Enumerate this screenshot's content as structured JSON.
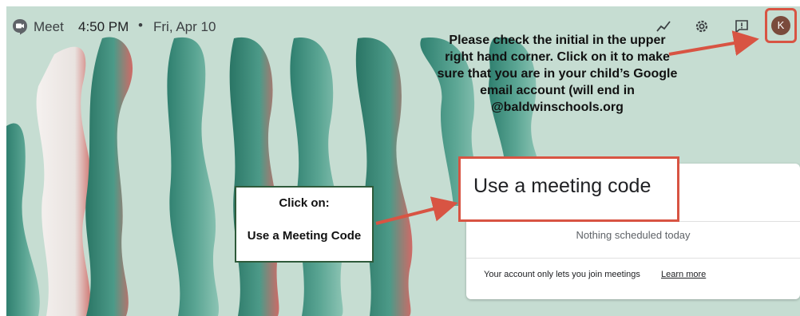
{
  "topbar": {
    "app_name": "Meet",
    "time": "4:50 PM",
    "separator": "•",
    "date": "Fri, Apr 10",
    "avatar_initial": "K"
  },
  "annotations": {
    "top_note": "Please check the initial in the upper right hand corner.  Click on it to make sure that you are in your child’s Google email account (will end in @baldwinschools.org",
    "click_on": "Click on:",
    "use_meeting_code_caption": "Use a Meeting Code"
  },
  "card": {
    "use_meeting_code": "Use a meeting code",
    "nothing_scheduled": "Nothing scheduled today",
    "account_notice": "Your account only lets you join meetings",
    "learn_more": "Learn more"
  },
  "colors": {
    "background": "#c6ddd2",
    "wave_teal": "#3f8f7e",
    "highlight_red": "#d85443",
    "note_box_border": "#2e5a3a"
  },
  "icons": [
    "meet-logo-icon",
    "activity-icon",
    "settings-icon",
    "feedback-icon"
  ]
}
